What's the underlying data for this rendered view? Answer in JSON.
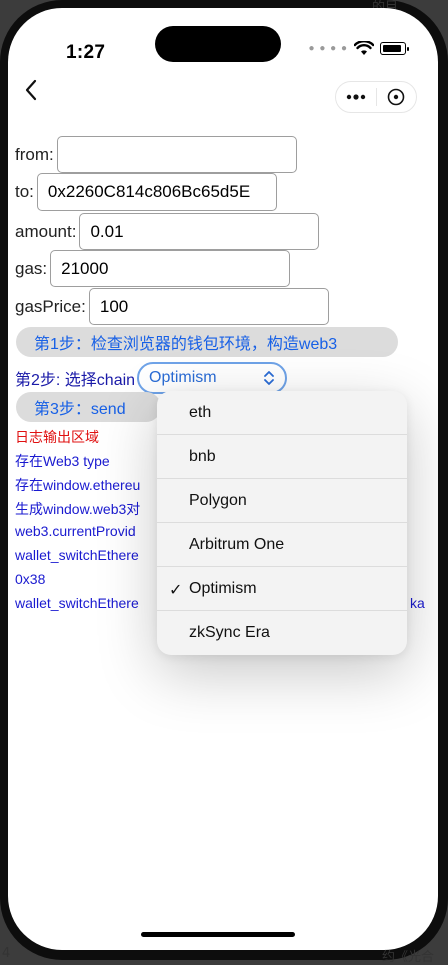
{
  "status_bar": {
    "time": "1:27"
  },
  "corner_text": {
    "top_right": "的目",
    "bottom_left": "4",
    "bottom_right": "约《光合"
  },
  "form": {
    "from": {
      "label": "from:",
      "value": ""
    },
    "to": {
      "label": "to:",
      "value": "0x2260C814c806Bc65d5E"
    },
    "amount": {
      "label": "amount:",
      "value": "0.01"
    },
    "gas": {
      "label": "gas:",
      "value": "21000"
    },
    "gasPrice": {
      "label": "gasPrice:",
      "value": "100"
    }
  },
  "step1": {
    "label": "第1步：检查浏览器的钱包环境，构造web3"
  },
  "step2": {
    "label": "第2步: 选择chain",
    "selected": "Optimism"
  },
  "step3": {
    "label": "第3步：send"
  },
  "log": {
    "title": "日志输出区域",
    "lines": [
      "存在Web3 type",
      "存在window.ethereu",
      "生成window.web3对",
      "web3.currentProvid",
      "wallet_switchEthere",
      "0x38",
      "wallet_switchEthere"
    ],
    "overflow_tail": "ka"
  },
  "dropdown": {
    "options": [
      "eth",
      "bnb",
      "Polygon",
      "Arbitrum One",
      "Optimism",
      "zkSync Era"
    ],
    "checked_index": 4
  },
  "colors": {
    "log_title": "#e01010",
    "log_text": "#1a1ad0",
    "button_text": "#1760e6",
    "select_border": "#6fa3e8"
  }
}
